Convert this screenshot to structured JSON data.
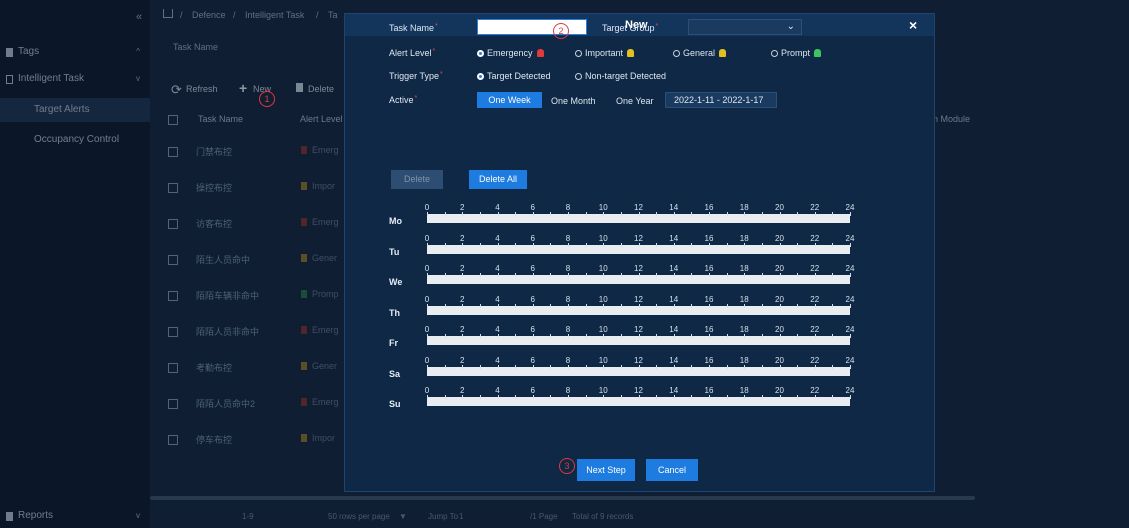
{
  "sidebar": {
    "collapse_glyph": "«",
    "items": [
      {
        "label": "Tags",
        "arrow": "^",
        "icon": "tag-icon"
      },
      {
        "label": "Intelligent Task",
        "arrow": "v",
        "icon": "task-icon"
      },
      {
        "label": "Target Alerts",
        "active": true
      },
      {
        "label": "Occupancy Control"
      }
    ],
    "reports": {
      "label": "Reports",
      "arrow": "v",
      "icon": "report-icon"
    }
  },
  "breadcrumb": {
    "home_icon": "home-icon",
    "sep": "/",
    "items": [
      "Defence",
      "Intelligent Task",
      "Ta"
    ]
  },
  "filter": {
    "task_name_label": "Task Name"
  },
  "toolbar": {
    "refresh": "Refresh",
    "new": "New",
    "delete": "Delete"
  },
  "table": {
    "headers": [
      "Task Name",
      "Alert Level"
    ],
    "right_header": "n Module",
    "rows": [
      {
        "name": "门禁布控",
        "level": "Emerg",
        "color": "#c0392b"
      },
      {
        "name": "操控布控",
        "level": "Impor",
        "color": "#d4a017"
      },
      {
        "name": "访客布控",
        "level": "Emerg",
        "color": "#c0392b"
      },
      {
        "name": "陌生人员命中",
        "level": "Gener",
        "color": "#d4a017"
      },
      {
        "name": "陌陌车辆非命中",
        "level": "Promp",
        "color": "#2e9e4f"
      },
      {
        "name": "陌陌人员非命中",
        "level": "Emerg",
        "color": "#c0392b"
      },
      {
        "name": "考勤布控",
        "level": "Gener",
        "color": "#d4a017"
      },
      {
        "name": "陌陌人员命中2",
        "level": "Emerg",
        "color": "#c0392b"
      },
      {
        "name": "停车布控",
        "level": "Impor",
        "color": "#d4a017"
      }
    ]
  },
  "pagination": {
    "range": "1-9",
    "rows_per_page": "50 rows per page",
    "jump_to": "Jump To",
    "page_input": "1",
    "pages": "/1 Page",
    "total": "Total of 9 records"
  },
  "modal": {
    "title": "New",
    "close": "×",
    "task_name_label": "Task Name",
    "task_name_value": "",
    "target_group_label": "Target Group",
    "target_group_value": "",
    "alert_level_label": "Alert Level",
    "alert_levels": [
      {
        "label": "Emergency",
        "checked": true,
        "color": "#e03a3a"
      },
      {
        "label": "Important",
        "checked": false,
        "color": "#e3c020"
      },
      {
        "label": "General",
        "checked": false,
        "color": "#e3c020"
      },
      {
        "label": "Prompt",
        "checked": false,
        "color": "#3ec45e"
      }
    ],
    "trigger_type_label": "Trigger Type",
    "trigger_types": [
      {
        "label": "Target Detected",
        "checked": true
      },
      {
        "label": "Non-target Detected",
        "checked": false
      }
    ],
    "active_label": "Active",
    "active_options": [
      "One Week",
      "One Month",
      "One Year"
    ],
    "active_selected": "One Week",
    "date_range": "2022-1-11 - 2022-1-17",
    "delete_btn": "Delete",
    "delete_all_btn": "Delete All",
    "days": [
      "Mo",
      "Tu",
      "We",
      "Th",
      "Fr",
      "Sa",
      "Su"
    ],
    "hours": [
      "0",
      "2",
      "4",
      "6",
      "8",
      "10",
      "12",
      "14",
      "16",
      "18",
      "20",
      "22",
      "24"
    ],
    "next_btn": "Next Step",
    "cancel_btn": "Cancel"
  },
  "annotations": [
    "1",
    "2",
    "3"
  ],
  "colors": {
    "accent": "#1e7ce0",
    "modal_bg": "#0e2845",
    "page_bg": "#13263f",
    "marker": "#e13838"
  }
}
